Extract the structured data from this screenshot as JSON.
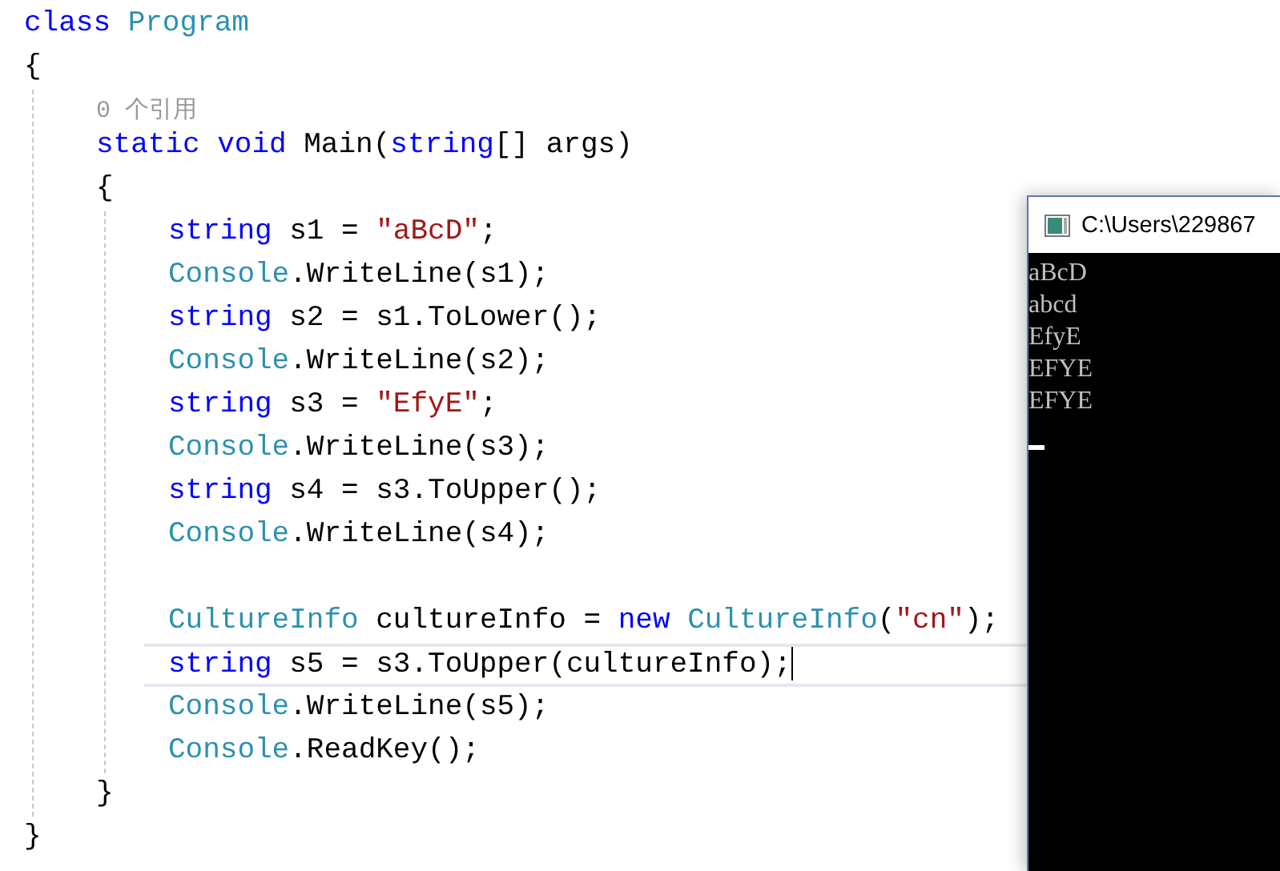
{
  "editor": {
    "lines": [
      {
        "kind": "code",
        "current": false,
        "tokens": [
          {
            "kind": "keyword",
            "text": "class "
          },
          {
            "kind": "type",
            "text": "Program"
          }
        ]
      },
      {
        "kind": "code",
        "current": false,
        "tokens": [
          {
            "kind": "plain",
            "text": "{"
          }
        ]
      },
      {
        "kind": "block",
        "children": [
          {
            "kind": "lens",
            "text": "0 个引用"
          },
          {
            "kind": "code",
            "current": false,
            "tokens": [
              {
                "kind": "keyword",
                "text": "static void"
              },
              {
                "kind": "plain",
                "text": " Main("
              },
              {
                "kind": "keyword",
                "text": "string"
              },
              {
                "kind": "plain",
                "text": "[] args)"
              }
            ]
          },
          {
            "kind": "code",
            "current": false,
            "tokens": [
              {
                "kind": "plain",
                "text": "{"
              }
            ]
          },
          {
            "kind": "block",
            "children": [
              {
                "kind": "code",
                "current": false,
                "tokens": [
                  {
                    "kind": "keyword",
                    "text": "string"
                  },
                  {
                    "kind": "plain",
                    "text": " s1 = "
                  },
                  {
                    "kind": "string",
                    "text": "\"aBcD\""
                  },
                  {
                    "kind": "plain",
                    "text": ";"
                  }
                ]
              },
              {
                "kind": "code",
                "current": false,
                "tokens": [
                  {
                    "kind": "type",
                    "text": "Console"
                  },
                  {
                    "kind": "plain",
                    "text": ".WriteLine(s1);"
                  }
                ]
              },
              {
                "kind": "code",
                "current": false,
                "tokens": [
                  {
                    "kind": "keyword",
                    "text": "string"
                  },
                  {
                    "kind": "plain",
                    "text": " s2 = s1.ToLower();"
                  }
                ]
              },
              {
                "kind": "code",
                "current": false,
                "tokens": [
                  {
                    "kind": "type",
                    "text": "Console"
                  },
                  {
                    "kind": "plain",
                    "text": ".WriteLine(s2);"
                  }
                ]
              },
              {
                "kind": "code",
                "current": false,
                "tokens": [
                  {
                    "kind": "keyword",
                    "text": "string"
                  },
                  {
                    "kind": "plain",
                    "text": " s3 = "
                  },
                  {
                    "kind": "string",
                    "text": "\"EfyE\""
                  },
                  {
                    "kind": "plain",
                    "text": ";"
                  }
                ]
              },
              {
                "kind": "code",
                "current": false,
                "tokens": [
                  {
                    "kind": "type",
                    "text": "Console"
                  },
                  {
                    "kind": "plain",
                    "text": ".WriteLine(s3);"
                  }
                ]
              },
              {
                "kind": "code",
                "current": false,
                "tokens": [
                  {
                    "kind": "keyword",
                    "text": "string"
                  },
                  {
                    "kind": "plain",
                    "text": " s4 = s3.ToUpper();"
                  }
                ]
              },
              {
                "kind": "code",
                "current": false,
                "tokens": [
                  {
                    "kind": "type",
                    "text": "Console"
                  },
                  {
                    "kind": "plain",
                    "text": ".WriteLine(s4);"
                  }
                ]
              },
              {
                "kind": "blank"
              },
              {
                "kind": "code",
                "current": false,
                "tokens": [
                  {
                    "kind": "type",
                    "text": "CultureInfo"
                  },
                  {
                    "kind": "plain",
                    "text": " cultureInfo = "
                  },
                  {
                    "kind": "keyword",
                    "text": "new "
                  },
                  {
                    "kind": "type",
                    "text": "CultureInfo"
                  },
                  {
                    "kind": "plain",
                    "text": "("
                  },
                  {
                    "kind": "string",
                    "text": "\"cn\""
                  },
                  {
                    "kind": "plain",
                    "text": ");"
                  }
                ]
              },
              {
                "kind": "code",
                "current": true,
                "tokens": [
                  {
                    "kind": "keyword",
                    "text": "string"
                  },
                  {
                    "kind": "plain",
                    "text": " s5 = s3.ToUpper(cultureInfo);"
                  }
                ]
              },
              {
                "kind": "code",
                "current": false,
                "tokens": [
                  {
                    "kind": "type",
                    "text": "Console"
                  },
                  {
                    "kind": "plain",
                    "text": ".WriteLine(s5);"
                  }
                ]
              },
              {
                "kind": "code",
                "current": false,
                "tokens": [
                  {
                    "kind": "type",
                    "text": "Console"
                  },
                  {
                    "kind": "plain",
                    "text": ".ReadKey();"
                  }
                ]
              }
            ]
          },
          {
            "kind": "code",
            "current": false,
            "tokens": [
              {
                "kind": "plain",
                "text": "}"
              }
            ]
          }
        ]
      },
      {
        "kind": "code",
        "current": false,
        "tokens": [
          {
            "kind": "plain",
            "text": "}"
          }
        ]
      }
    ]
  },
  "console": {
    "title": "C:\\Users\\229867",
    "output": [
      "aBcD",
      "abcd",
      "EfyE",
      "EFYE",
      "EFYE"
    ]
  }
}
